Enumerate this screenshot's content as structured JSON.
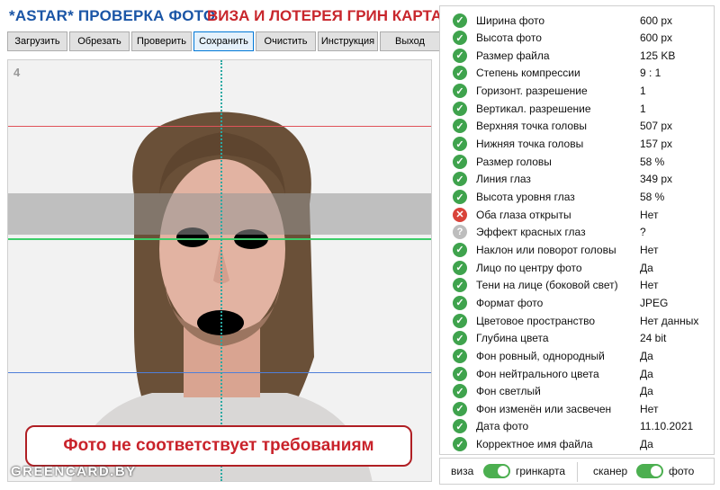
{
  "header": {
    "title_left": "*ASTAR* ПРОВЕРКА ФОТО",
    "title_right": "ВИЗА И ЛОТЕРЕЯ ГРИН КАРТА"
  },
  "toolbar": {
    "buttons": [
      "Загрузить",
      "Обрезать",
      "Проверить",
      "Сохранить",
      "Очистить",
      "Инструкция",
      "Выход"
    ],
    "active": "Сохранить"
  },
  "photo": {
    "number": "4",
    "warning": "Фото не соответствует требованиям",
    "watermark": "GREENCARD.BY"
  },
  "colors": {
    "pass": "#3fa34d",
    "fail": "#d9433a",
    "unknown": "#bdbdbd",
    "accent": "#1a55a6",
    "alert": "#c9232b"
  },
  "checks": [
    {
      "label": "Ширина фото",
      "value": "600 px",
      "status": "pass"
    },
    {
      "label": "Высота фото",
      "value": "600 px",
      "status": "pass"
    },
    {
      "label": "Размер файла",
      "value": "125 KB",
      "status": "pass"
    },
    {
      "label": "Степень компрессии",
      "value": "9 : 1",
      "status": "pass"
    },
    {
      "label": "Горизонт. разрешение",
      "value": "1",
      "status": "pass"
    },
    {
      "label": "Вертикал. разрешение",
      "value": "1",
      "status": "pass"
    },
    {
      "label": "Верхняя точка головы",
      "value": "507 px",
      "status": "pass"
    },
    {
      "label": "Нижняя точка головы",
      "value": "157 px",
      "status": "pass"
    },
    {
      "label": "Размер головы",
      "value": "58 %",
      "status": "pass"
    },
    {
      "label": "Линия глаз",
      "value": "349 px",
      "status": "pass"
    },
    {
      "label": "Высота уровня глаз",
      "value": "58 %",
      "status": "pass"
    },
    {
      "label": "Оба глаза открыты",
      "value": "Нет",
      "status": "fail"
    },
    {
      "label": "Эффект красных глаз",
      "value": "?",
      "status": "unknown"
    },
    {
      "label": "Наклон или поворот головы",
      "value": "Нет",
      "status": "pass"
    },
    {
      "label": "Лицо по центру фото",
      "value": "Да",
      "status": "pass"
    },
    {
      "label": "Тени на лице (боковой свет)",
      "value": "Нет",
      "status": "pass"
    },
    {
      "label": "Формат фото",
      "value": "JPEG",
      "status": "pass"
    },
    {
      "label": "Цветовое пространство",
      "value": "Нет данных",
      "status": "pass"
    },
    {
      "label": "Глубина цвета",
      "value": "24 bit",
      "status": "pass"
    },
    {
      "label": "Фон ровный, однородный",
      "value": "Да",
      "status": "pass"
    },
    {
      "label": "Фон нейтрального цвета",
      "value": "Да",
      "status": "pass"
    },
    {
      "label": "Фон светлый",
      "value": "Да",
      "status": "pass"
    },
    {
      "label": "Фон изменён или засвечен",
      "value": "Нет",
      "status": "pass"
    },
    {
      "label": "Дата фото",
      "value": "11.10.2021",
      "status": "pass"
    },
    {
      "label": "Корректное имя файла",
      "value": "Да",
      "status": "pass"
    }
  ],
  "bottom": {
    "left_off": "виза",
    "left_on": "гринкарта",
    "right_off": "сканер",
    "right_on": "фото",
    "left_toggle_on": true,
    "right_toggle_on": true
  }
}
